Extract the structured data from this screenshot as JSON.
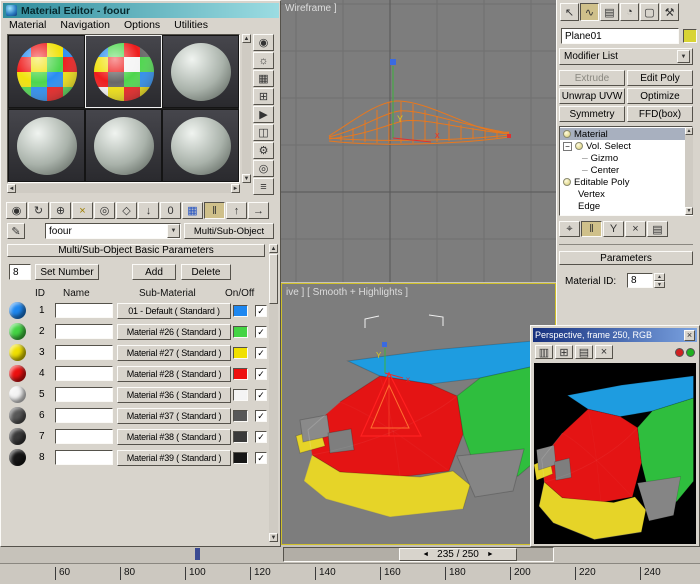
{
  "material_editor": {
    "title": "Material Editor - foour",
    "menu": [
      "Material",
      "Navigation",
      "Options",
      "Utilities"
    ],
    "name_value": "foour",
    "type_label": "Multi/Sub-Object",
    "rollout_title": "Multi/Sub-Object Basic Parameters",
    "count": "8",
    "set_number": "Set Number",
    "add": "Add",
    "delete": "Delete",
    "col_id": "ID",
    "col_name": "Name",
    "col_sub": "Sub-Material",
    "col_onoff": "On/Off",
    "rows": [
      {
        "id": "1",
        "name": "",
        "sub": "01 - Default  ( Standard )",
        "color": "#1d87f0"
      },
      {
        "id": "2",
        "name": "",
        "sub": "Material #26  ( Standard )",
        "color": "#44d444"
      },
      {
        "id": "3",
        "name": "",
        "sub": "Material #27  ( Standard )",
        "color": "#f0e000"
      },
      {
        "id": "4",
        "name": "",
        "sub": "Material #28  ( Standard )",
        "color": "#ee1010"
      },
      {
        "id": "5",
        "name": "",
        "sub": "Material #36  ( Standard )",
        "color": "#f4f4f4"
      },
      {
        "id": "6",
        "name": "",
        "sub": "Material #37  ( Standard )",
        "color": "#585858"
      },
      {
        "id": "7",
        "name": "",
        "sub": "Material #38  ( Standard )",
        "color": "#3a3a3a"
      },
      {
        "id": "8",
        "name": "",
        "sub": "Material #39  ( Standard )",
        "color": "#161616"
      }
    ]
  },
  "viewport_top": {
    "label": "Wireframe ]"
  },
  "viewport_bottom": {
    "label": "ive ]  [ Smooth + Highlights ]"
  },
  "command_panel": {
    "object_name": "Plane01",
    "modifier_list": "Modifier List",
    "buttons": [
      "Extrude",
      "Edit Poly",
      "Unwrap UVW",
      "Optimize",
      "Symmetry",
      "FFD(box)"
    ],
    "stack": [
      "Material",
      "Vol. Select",
      "Gizmo",
      "Center",
      "Editable Poly",
      "Vertex",
      "Edge"
    ],
    "parameters": "Parameters",
    "material_id_label": "Material ID:",
    "material_id": "8"
  },
  "render_window": {
    "title": "Perspective, frame 250, RGB"
  },
  "timeline": {
    "slider": "235 / 250",
    "ruler": [
      "60",
      "80",
      "100",
      "120",
      "140",
      "160",
      "180",
      "200",
      "220",
      "240"
    ]
  },
  "icons": {
    "check": "✓",
    "close": "×",
    "up": "▲",
    "down": "▼",
    "left": "◄",
    "right": "►",
    "dash": "─",
    "minus": "−",
    "eyedropper": "✎",
    "me_column": [
      "◉",
      "☼",
      "▦",
      "⊞",
      "▶",
      "◫",
      "⚙",
      "◎",
      "≡"
    ],
    "me_toolbar": [
      "◉",
      "↻",
      "⊕",
      "×",
      "◎",
      "◇",
      "↓",
      "0",
      "▦",
      "‖",
      "↑",
      "→"
    ],
    "panel_tabs": [
      "↖",
      "∿",
      "▤",
      "◔",
      "▢",
      "⚒"
    ],
    "stack_tools": [
      "⌖",
      "‖",
      "Y",
      "×",
      "▤"
    ],
    "rw_toolbar": [
      "▥",
      "⊞",
      "▤",
      "×"
    ]
  },
  "colors": {
    "terrain_blue": "#1e9ce0",
    "terrain_green": "#2fbe3e",
    "terrain_red": "#e41414",
    "terrain_yellow": "#e6d428",
    "terrain_gray": "#8a8a8a",
    "wire_orange": "#e8781e"
  }
}
